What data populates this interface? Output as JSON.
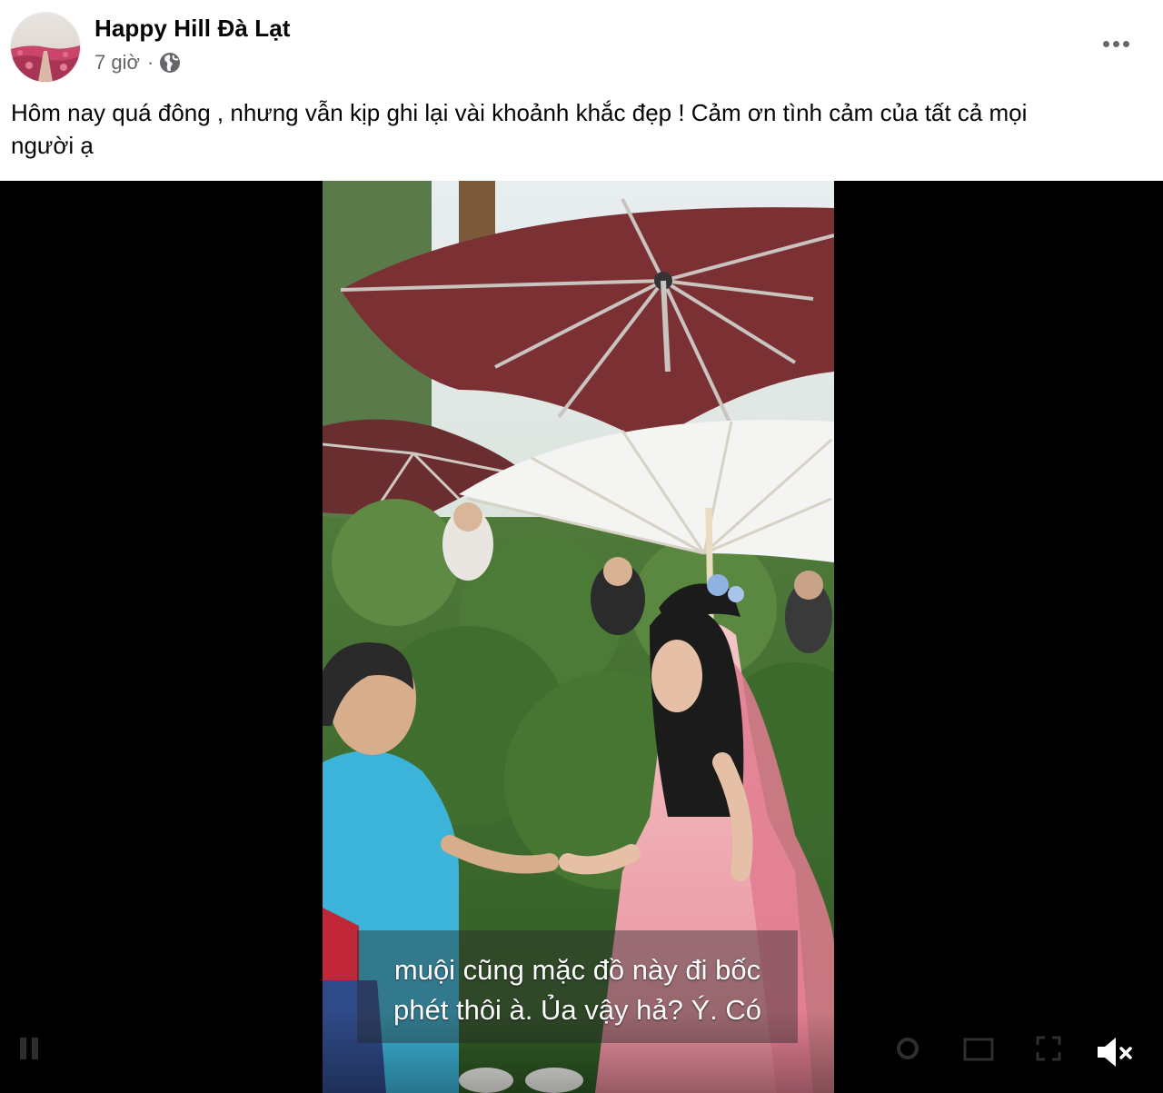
{
  "post": {
    "page_name": "Happy Hill Đà Lạt",
    "timestamp": "7 giờ",
    "separator": "·",
    "privacy_icon": "globe-icon",
    "more_icon": "more-dots-icon",
    "caption_line1": "Hôm nay quá đông , nhưng vẫn kịp ghi lại vài khoảnh khắc đẹp ! Cảm ơn tình cảm của tất cả mọi",
    "caption_line2": "người ạ"
  },
  "video": {
    "subtitle_line1": "muội cũng mặc đồ này đi bốc",
    "subtitle_line2": "phét thôi à. Ủa vậy hả? Ý. Có",
    "mute_icon": "speaker-muted-icon",
    "muted": true
  },
  "colors": {
    "text_primary": "#050505",
    "text_secondary": "#65676b",
    "video_background": "#000000"
  }
}
